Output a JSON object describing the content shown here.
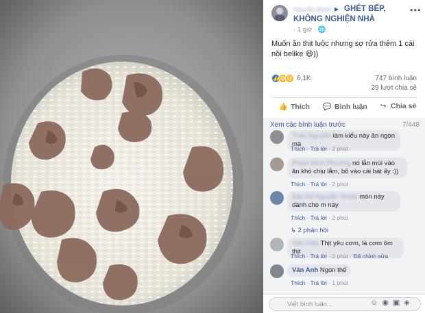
{
  "post": {
    "author": "Nguyễn Mạnh Tùng",
    "group": "GHÉT BẾP, KHÔNG NGHIỆN NHÀ",
    "time": "· 1 giờ ·",
    "text": "Muốn ăn thịt luộc nhưng sợ rửa thêm 1 cái nồi belike 😄))",
    "reactions_count": "6,1K",
    "comments_count": "747 bình luận",
    "shares_count": "29 lượt chia sẻ"
  },
  "actions": {
    "like": "Thích",
    "comment": "Bình luận",
    "share": "Chia sẻ"
  },
  "comments_header": {
    "more_link": "Xem các bình luận trước",
    "count": "7/448"
  },
  "comments": [
    {
      "name": "Thảo Nguyễn",
      "text": "làm kiểu này ăn ngon mà",
      "like": "Thích",
      "reply": "Trả lời",
      "time": "2 phút"
    },
    {
      "name": "Phạm Minh Phương",
      "text": "nó lẫn mùi vào ăn khó chịu lắm, bỏ vào cái bát ấy :))",
      "like": "Thích",
      "reply": "Trả lời",
      "time": "2 phút"
    },
    {
      "name": "Bảo Đỗ Nguyễn Shelly",
      "text": "món này dành cho m này",
      "like": "Thích",
      "reply": "Trả lời",
      "time": "2 phút",
      "replies": "↳ 2 phản hồi"
    },
    {
      "name": "Vân Hiệp",
      "text": "Thịt yêu cơm, là cơm ôm thịt",
      "like": "Thích",
      "reply": "Trả lời",
      "time": "2 phút",
      "edited": "Đã chỉnh sửa"
    },
    {
      "name": "Vân Anh",
      "text": "Ngon thế",
      "like": "Thích",
      "reply": "Trả lời",
      "time": "1 phút"
    }
  ],
  "reply": {
    "placeholder": "Viết bình luận..."
  },
  "colors": {
    "link": "#385898",
    "like_blue": "#1877f2",
    "haha_yellow": "#f7b125"
  }
}
